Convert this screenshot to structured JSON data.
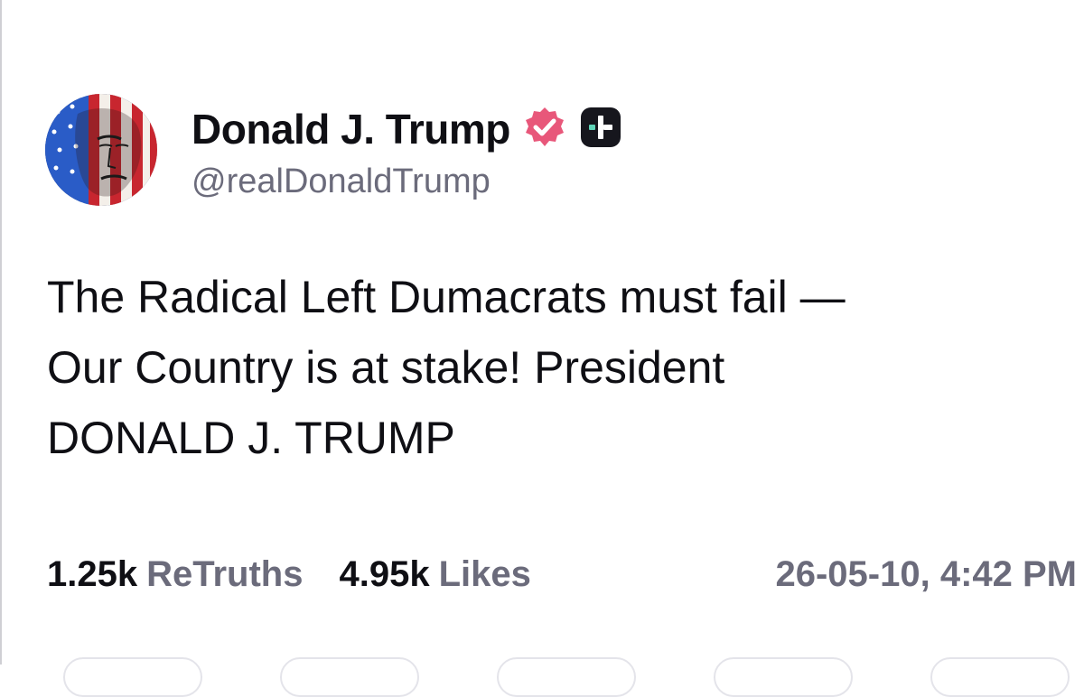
{
  "post": {
    "author": {
      "display_name": "Donald J. Trump",
      "handle": "@realDonaldTrump",
      "avatar_icon": "flag-face-avatar",
      "verified_icon": "verified-badge-icon",
      "plus_icon": "truth-plus-icon"
    },
    "text_lines": [
      "The Radical Left Dumacrats must fail —",
      "Our Country is at stake! President",
      "DONALD J. TRUMP"
    ],
    "stats": {
      "retruths_count": "1.25k",
      "retruths_label": "ReTruths",
      "likes_count": "4.95k",
      "likes_label": "Likes",
      "timestamp": "26-05-10, 4:42 PM"
    }
  },
  "colors": {
    "verified_badge": "#e8577a",
    "plus_badge": "#16161d",
    "plus_accent": "#5fd4b8",
    "muted_text": "#6b6b7b",
    "primary_text": "#0f0f14"
  }
}
